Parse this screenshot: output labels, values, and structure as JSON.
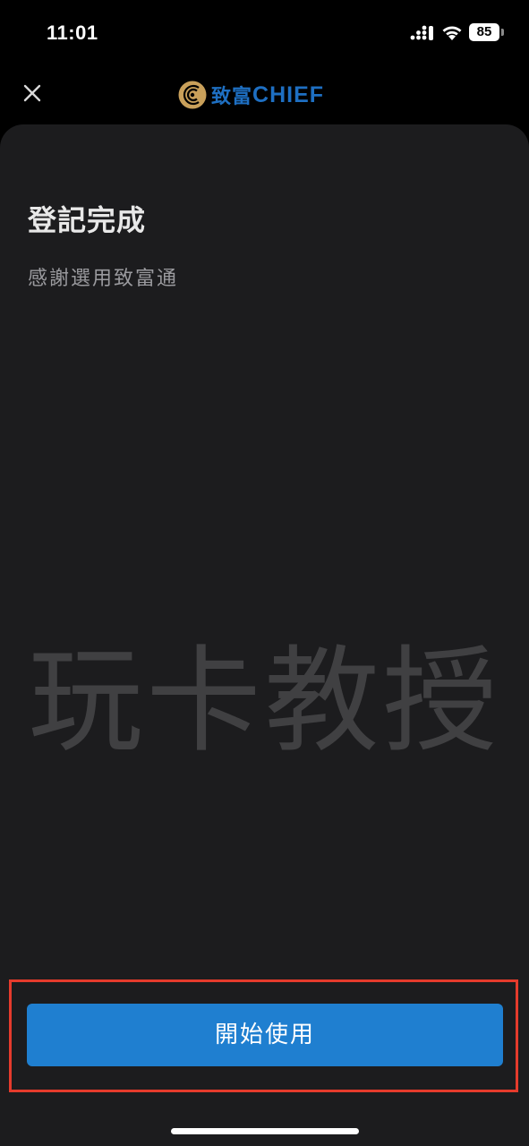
{
  "status_bar": {
    "time": "11:01",
    "battery": "85"
  },
  "header": {
    "logo_cn": "致富",
    "logo_en": "CHIEF",
    "close_icon": "close-icon"
  },
  "content": {
    "title": "登記完成",
    "subtitle": "感謝選用致富通"
  },
  "watermark": "玩卡教授",
  "actions": {
    "start_label": "開始使用"
  },
  "colors": {
    "background": "#000000",
    "card": "#1c1c1e",
    "accent": "#1f7fd0",
    "logo_blue": "#1e6fc2",
    "logo_gold": "#c9a05a",
    "highlight": "#e53b2c"
  }
}
